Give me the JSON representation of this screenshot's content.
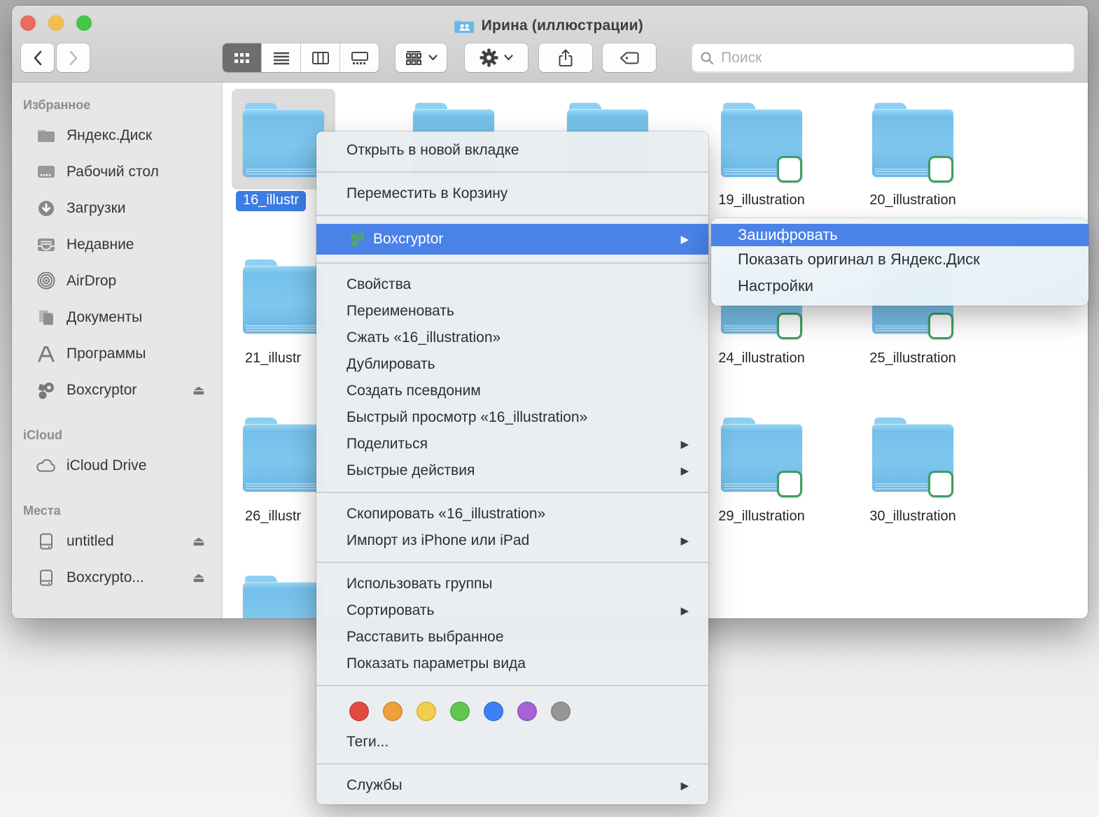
{
  "window": {
    "title": "Ирина (иллюстрации)"
  },
  "toolbar": {
    "search_placeholder": "Поиск",
    "views": [
      "grid",
      "list",
      "columns",
      "gallery"
    ],
    "selected_view": "grid"
  },
  "sidebar": {
    "sections": [
      {
        "label": "Избранное",
        "items": [
          {
            "label": "Яндекс.Диск",
            "icon": "folder",
            "eject": false
          },
          {
            "label": "Рабочий стол",
            "icon": "desktop",
            "eject": false
          },
          {
            "label": "Загрузки",
            "icon": "downloads",
            "eject": false
          },
          {
            "label": "Недавние",
            "icon": "recents",
            "eject": false
          },
          {
            "label": "AirDrop",
            "icon": "airdrop",
            "eject": false
          },
          {
            "label": "Документы",
            "icon": "documents",
            "eject": false
          },
          {
            "label": "Программы",
            "icon": "applications",
            "eject": false
          },
          {
            "label": "Boxcryptor",
            "icon": "boxcryptor",
            "eject": true
          }
        ]
      },
      {
        "label": "iCloud",
        "items": [
          {
            "label": "iCloud Drive",
            "icon": "cloud",
            "eject": false
          }
        ]
      },
      {
        "label": "Места",
        "items": [
          {
            "label": "untitled",
            "icon": "drive",
            "eject": true
          },
          {
            "label": "Boxcrypto...",
            "icon": "drive",
            "eject": true
          }
        ]
      }
    ]
  },
  "content": {
    "folders": [
      {
        "name": "16_illustr",
        "col": 1,
        "row": 1,
        "selected": true,
        "badge": false,
        "label_style": "pill"
      },
      {
        "name": "",
        "col": 2,
        "row": 1,
        "selected": false,
        "badge": false,
        "label_style": "none"
      },
      {
        "name": "",
        "col": 3,
        "row": 1,
        "selected": false,
        "badge": false,
        "label_style": "none"
      },
      {
        "name": "19_illustration",
        "col": 4,
        "row": 1,
        "selected": false,
        "badge": true,
        "label_style": "center"
      },
      {
        "name": "20_illustration",
        "col": 5,
        "row": 1,
        "selected": false,
        "badge": true,
        "label_style": "center"
      },
      {
        "name": "21_illustr",
        "col": 1,
        "row": 2,
        "selected": false,
        "badge": false,
        "label_style": "left"
      },
      {
        "name": "24_illustration",
        "col": 4,
        "row": 2,
        "selected": false,
        "badge": true,
        "label_style": "center"
      },
      {
        "name": "25_illustration",
        "col": 5,
        "row": 2,
        "selected": false,
        "badge": true,
        "label_style": "center"
      },
      {
        "name": "26_illustr",
        "col": 1,
        "row": 3,
        "selected": false,
        "badge": false,
        "label_style": "left"
      },
      {
        "name": "29_illustration",
        "col": 4,
        "row": 3,
        "selected": false,
        "badge": true,
        "label_style": "center"
      },
      {
        "name": "30_illustration",
        "col": 5,
        "row": 3,
        "selected": false,
        "badge": true,
        "label_style": "center"
      },
      {
        "name": "",
        "col": 1,
        "row": 4,
        "selected": false,
        "badge": false,
        "label_style": "none"
      }
    ]
  },
  "context_menu": {
    "items": [
      {
        "label": "Открыть в новой вкладке"
      },
      {
        "type": "sep"
      },
      {
        "label": "Переместить в Корзину"
      },
      {
        "type": "sep"
      },
      {
        "label": "Boxcryptor",
        "highlighted": true,
        "icon": "boxcryptor",
        "arrow": true
      },
      {
        "type": "sep"
      },
      {
        "label": "Свойства"
      },
      {
        "label": "Переименовать"
      },
      {
        "label": "Сжать «16_illustration»"
      },
      {
        "label": "Дублировать"
      },
      {
        "label": "Создать псевдоним"
      },
      {
        "label": "Быстрый просмотр «16_illustration»"
      },
      {
        "label": "Поделиться",
        "arrow": true
      },
      {
        "label": "Быстрые действия",
        "arrow": true
      },
      {
        "type": "sep"
      },
      {
        "label": "Скопировать «16_illustration»"
      },
      {
        "label": "Импорт из iPhone или iPad",
        "arrow": true
      },
      {
        "type": "sep"
      },
      {
        "label": "Использовать группы"
      },
      {
        "label": "Сортировать",
        "arrow": true
      },
      {
        "label": "Расставить выбранное"
      },
      {
        "label": "Показать параметры вида"
      },
      {
        "type": "sep"
      },
      {
        "type": "tags"
      },
      {
        "label": "Теги..."
      },
      {
        "type": "sep"
      },
      {
        "label": "Службы",
        "arrow": true
      }
    ],
    "tag_colors": [
      "#e14b40",
      "#ef9f3c",
      "#f3ce4b",
      "#63c74f",
      "#3c81f6",
      "#a861d6",
      "#969696"
    ]
  },
  "submenu": {
    "items": [
      {
        "label": "Зашифровать",
        "highlighted": true
      },
      {
        "label": "Показать оригинал в Яндекс.Диск"
      },
      {
        "label": "Настройки"
      }
    ]
  },
  "colors": {
    "highlight_blue": "#4a82e8",
    "selected_label_blue": "#3c7ce4",
    "folder_blue": "#74c0ea",
    "badge_green": "#3f9d63",
    "boxcryptor_green": "#54a566",
    "traffic_red": "#ee6a5f",
    "traffic_yellow": "#f5bd4f",
    "traffic_green": "#45c646"
  }
}
